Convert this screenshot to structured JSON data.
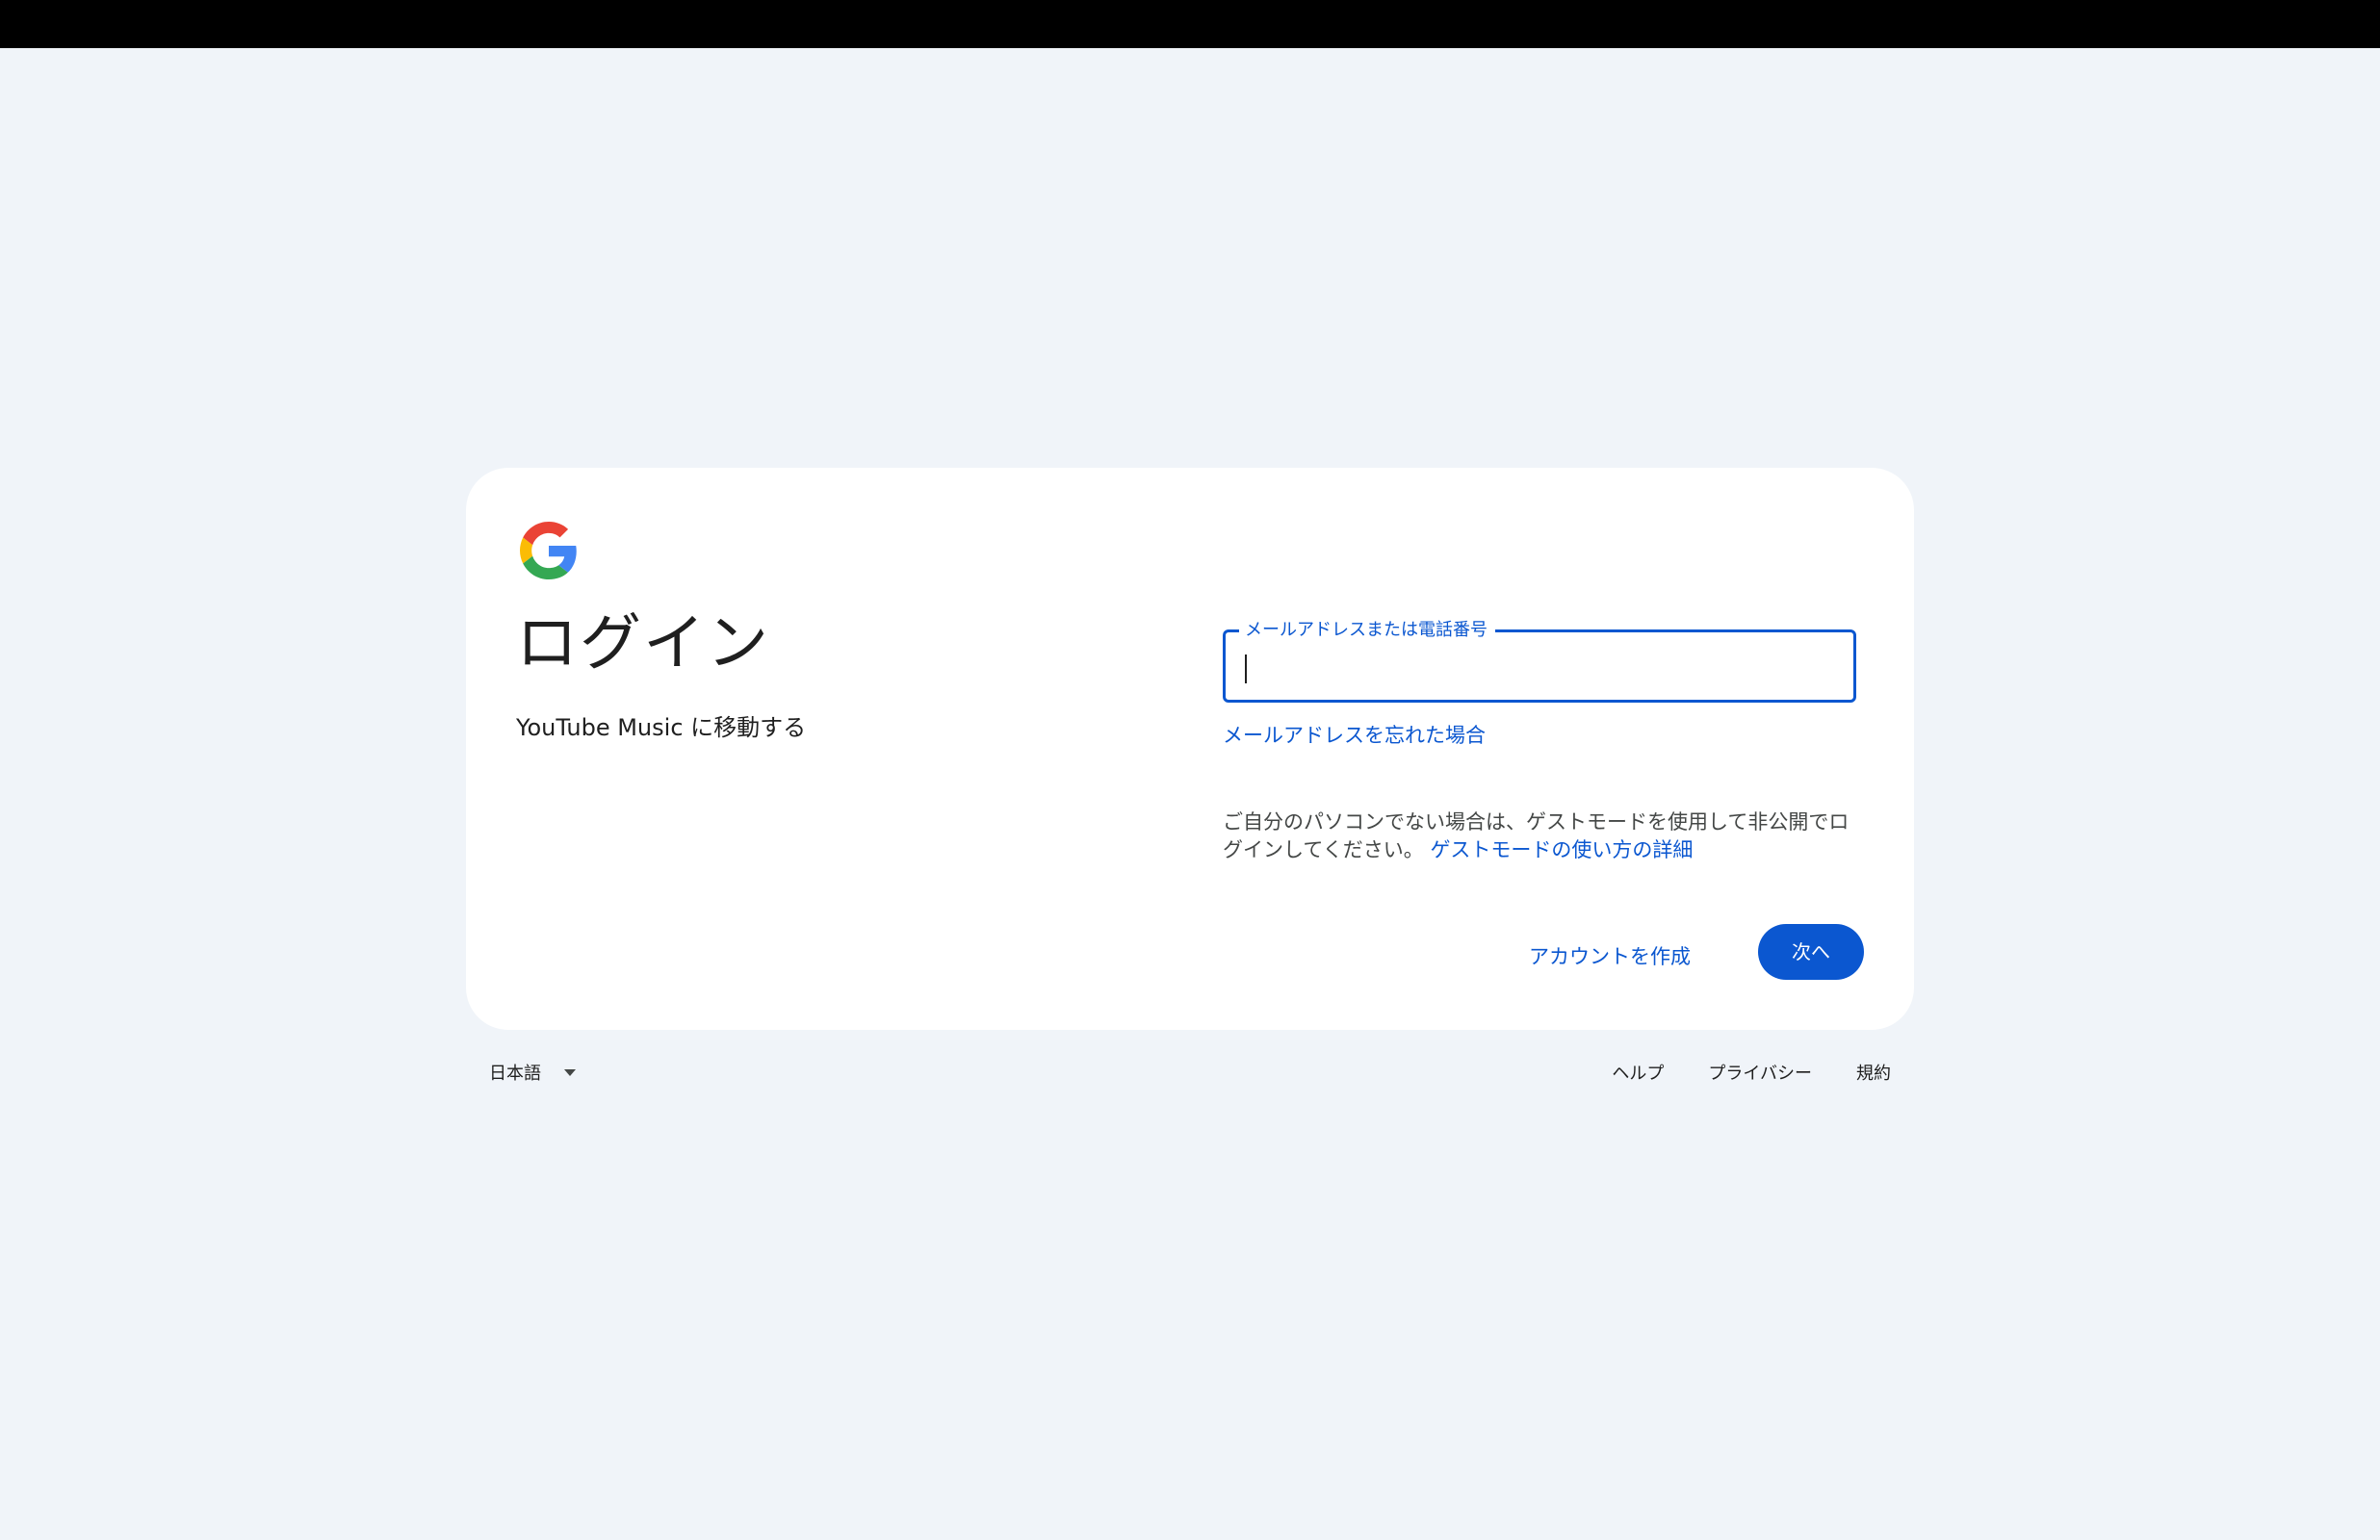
{
  "page": {
    "background": "#f0f4f9",
    "accent_color": "#0b57d0"
  },
  "card": {
    "logo": "google-g-logo",
    "title": "ログイン",
    "subtitle": "YouTube Music に移動する"
  },
  "email_field": {
    "label": "メールアドレスまたは電話番号",
    "value": ""
  },
  "forgot_email_link": "メールアドレスを忘れた場合",
  "guest_notice": {
    "text": "ご自分のパソコンでない場合は、ゲストモードを使用して非公開でログインしてください。",
    "link": "ゲストモードの使い方の詳細"
  },
  "actions": {
    "create_account": "アカウントを作成",
    "next": "次へ"
  },
  "footer": {
    "language": "日本語",
    "links": [
      "ヘルプ",
      "プライバシー",
      "規約"
    ]
  }
}
